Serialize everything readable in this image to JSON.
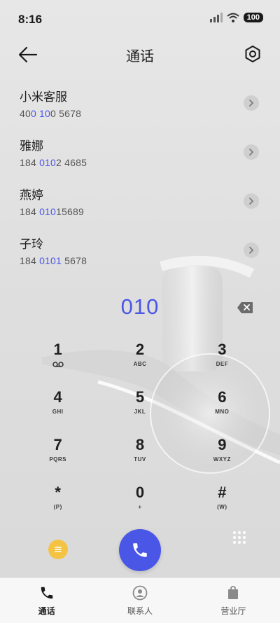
{
  "status_bar": {
    "time": "8:16",
    "battery": "100"
  },
  "header": {
    "title": "通话"
  },
  "contacts": [
    {
      "name": "小米客服",
      "number_parts": [
        "40",
        "0 10",
        "0 5678"
      ]
    },
    {
      "name": "雅娜",
      "number_parts": [
        "184 ",
        "010",
        "2 4685"
      ]
    },
    {
      "name": "燕婷",
      "number_parts": [
        "184 ",
        "010",
        "15689"
      ]
    },
    {
      "name": "子玲",
      "number_parts": [
        "184 ",
        "0101",
        " 5678"
      ]
    }
  ],
  "dialed_number": "010",
  "keypad": [
    {
      "digit": "1",
      "letters": "",
      "icon": "voicemail-icon"
    },
    {
      "digit": "2",
      "letters": "ABC"
    },
    {
      "digit": "3",
      "letters": "DEF"
    },
    {
      "digit": "4",
      "letters": "GHI"
    },
    {
      "digit": "5",
      "letters": "JKL"
    },
    {
      "digit": "6",
      "letters": "MNO"
    },
    {
      "digit": "7",
      "letters": "PQRS"
    },
    {
      "digit": "8",
      "letters": "TUV"
    },
    {
      "digit": "9",
      "letters": "WXYZ"
    },
    {
      "digit": "*",
      "letters": "(P)"
    },
    {
      "digit": "0",
      "letters": "+"
    },
    {
      "digit": "#",
      "letters": "(W)"
    }
  ],
  "bottom_nav": {
    "calls": "通话",
    "contacts": "联系人",
    "business": "营业厅"
  },
  "colors": {
    "accent": "#4a56e6",
    "menu_button": "#f5c342"
  }
}
